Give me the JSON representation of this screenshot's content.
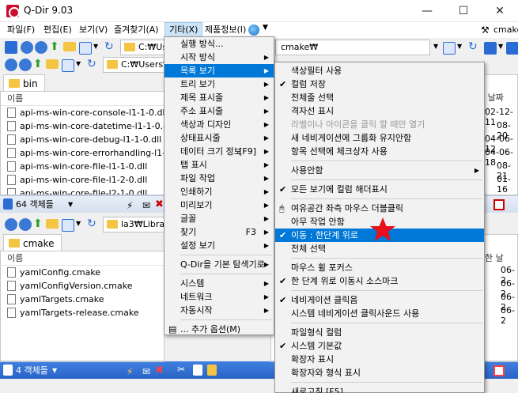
{
  "window": {
    "title": "Q-Dir 9.03",
    "minimize": "—",
    "maximize": "☐",
    "close": "✕"
  },
  "menubar": {
    "items": [
      "파일(F)",
      "편집(E)",
      "보기(V)",
      "즐겨찾기(A)",
      "기타(X)",
      "제품정보(I)"
    ],
    "right_user": "cmake"
  },
  "toolbar": {
    "top_left_addr": "C:₩Us",
    "top_right_addr": "cmake₩",
    "mid_left_addr": "C:₩Users₩je",
    "bottom_left_addr": "la3₩Library₩"
  },
  "pane_top_left": {
    "tab": "bin",
    "column_name": "이름",
    "files": [
      "api-ms-win-core-console-l1-1-0.dll",
      "api-ms-win-core-datetime-l1-1-0.dll",
      "api-ms-win-core-debug-l1-1-0.dll",
      "api-ms-win-core-errorhandling-l1-1-0.dll",
      "api-ms-win-core-file-l1-1-0.dll",
      "api-ms-win-core-file-l1-2-0.dll",
      "api-ms-win-core-file-l2-1-0.dll"
    ],
    "status": "64 객체들"
  },
  "pane_top_right": {
    "column_date": "한 날짜",
    "dates": [
      "02-12-11",
      "08-20",
      "04-06-12",
      "04-06-18",
      "08-21",
      "01-16"
    ]
  },
  "pane_bottom_left": {
    "tab": "cmake",
    "column_name": "이름",
    "files": [
      "yamlConfig.cmake",
      "yamlConfigVersion.cmake",
      "yamlTargets.cmake",
      "yamlTargets-release.cmake"
    ],
    "status": "4 객체들"
  },
  "pane_bottom_right": {
    "column_date": "한 날",
    "dates": [
      "06-2",
      "06-2",
      "06-2",
      "06-2"
    ]
  },
  "menu_main": {
    "items": [
      {
        "label": "실행 방식...",
        "arrow": false
      },
      {
        "label": "시작 방식",
        "arrow": true
      },
      {
        "label": "목록 보기",
        "arrow": true,
        "selected": true
      },
      {
        "label": "트리 보기",
        "arrow": true
      },
      {
        "label": "제목 표시줄",
        "arrow": true
      },
      {
        "label": "주소 표시줄",
        "arrow": true
      },
      {
        "label": "색상과 디자인",
        "arrow": true
      },
      {
        "label": "상태표시줄",
        "arrow": true
      },
      {
        "label": "데이터 크기 정보",
        "shortcut": "[F9]",
        "arrow": true
      },
      {
        "label": "탭 표시",
        "arrow": true
      },
      {
        "label": "파일 작업",
        "arrow": true
      },
      {
        "label": "인쇄하기",
        "arrow": true
      },
      {
        "label": "미리보기",
        "arrow": true
      },
      {
        "label": "글꼴",
        "arrow": true
      },
      {
        "label": "찾기",
        "shortcut": "F3",
        "arrow": true
      },
      {
        "label": "설정 보기",
        "arrow": true
      },
      {
        "sep": true
      },
      {
        "label": "Q-Dir을 기본 탐색기로",
        "arrow": true
      },
      {
        "sep": true
      },
      {
        "label": "시스템",
        "arrow": true
      },
      {
        "label": "네트워크",
        "arrow": true
      },
      {
        "label": "자동시작",
        "arrow": true
      },
      {
        "sep": true
      },
      {
        "label": "... 추가 옵션(M)",
        "arrow": false,
        "icon": true
      }
    ]
  },
  "menu_sub": {
    "items": [
      {
        "label": "색상필터 사용"
      },
      {
        "label": "컬럼 저장",
        "check": true
      },
      {
        "label": "전체줄 선택"
      },
      {
        "label": "격자선 표시"
      },
      {
        "label": "라벨이나 아이콘을 클릭 할 때만 열기",
        "disabled": true
      },
      {
        "label": "새 네비게이션에 그룹화 유지안함"
      },
      {
        "label": "항목 선택에 체크상자 사용"
      },
      {
        "sep": true
      },
      {
        "label": "사용안함",
        "arrow": true
      },
      {
        "sep": true
      },
      {
        "label": "모든 보기에 컬럼 해더표시",
        "check": true
      },
      {
        "sep": true
      },
      {
        "label": "여유공간 좌측 마우스 더블클릭",
        "icon": "mouse"
      },
      {
        "label": "아무 작업 안함"
      },
      {
        "label": "이동 : 한단계 위로",
        "check": true,
        "selected": true
      },
      {
        "label": "전체 선택"
      },
      {
        "sep": true
      },
      {
        "label": "마우스 휠 포커스"
      },
      {
        "label": "한 단계 위로 이동시 소스마크",
        "check": true
      },
      {
        "sep": true
      },
      {
        "label": "네비게이션 클릭음",
        "check": true
      },
      {
        "label": "시스템 네비게이션 클릭사운드 사용"
      },
      {
        "sep": true
      },
      {
        "label": "파일형식 컬럼"
      },
      {
        "label": "시스템 기본값",
        "check": true
      },
      {
        "label": "확장자 표시"
      },
      {
        "label": "확장자와 형식 표시"
      },
      {
        "sep": true
      },
      {
        "label": "새로고침 [F5]"
      }
    ]
  },
  "colors": {
    "accent": "#0078d7",
    "star": "#e8101a",
    "folder": "#f4c542"
  }
}
